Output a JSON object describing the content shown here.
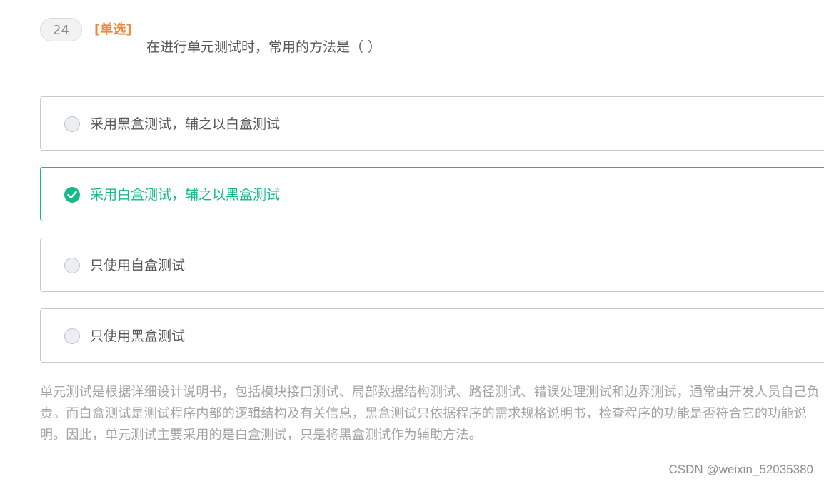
{
  "question": {
    "number": "24",
    "type_label": "[单选]",
    "text": "在进行单元测试时，常用的方法是（ ）"
  },
  "options": [
    {
      "label": "采用黑盒测试，辅之以白盒测试",
      "selected": false
    },
    {
      "label": "采用白盒测试，辅之以黑盒测试",
      "selected": true
    },
    {
      "label": "只使用自盒测试",
      "selected": false
    },
    {
      "label": "只使用黑盒测试",
      "selected": false
    }
  ],
  "explanation": "单元测试是根据详细设计说明书，包括模块接口测试、局部数据结构测试、路径测试、错误处理测试和边界测试，通常由开发人员自己负责。而白盒测试是测试程序内部的逻辑结构及有关信息，黑盒测试只依据程序的需求规格说明书，检查程序的功能是否符合它的功能说明。因此，单元测试主要采用的是白盒测试，只是将黑盒测试作为辅助方法。",
  "watermark": "CSDN @weixin_52035380",
  "colors": {
    "accent_selected": "#16b98a",
    "type_label": "#f0883a",
    "explanation_text": "#a3a3a3"
  }
}
